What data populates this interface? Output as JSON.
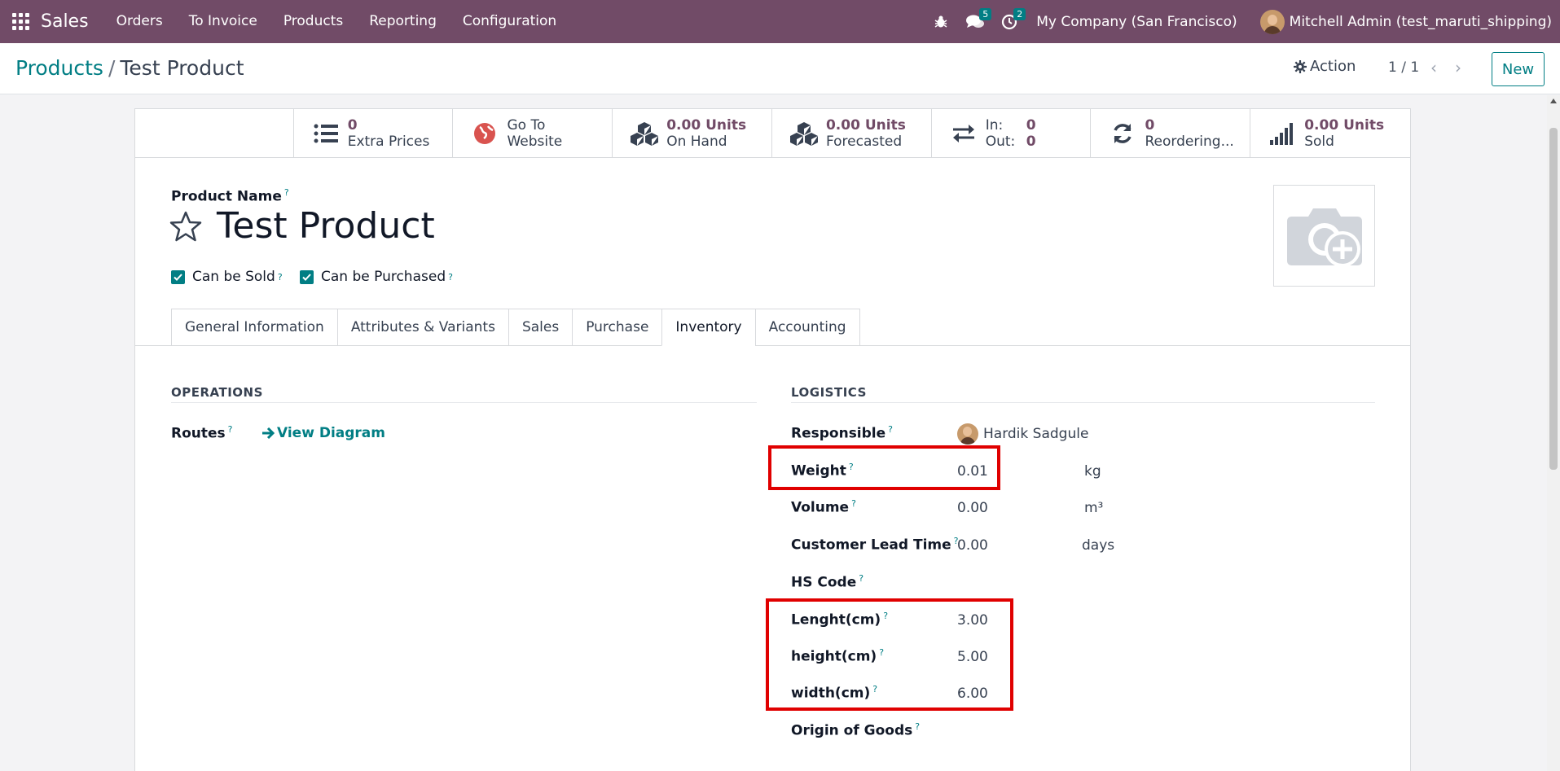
{
  "navbar": {
    "app_title": "Sales",
    "menu": [
      "Orders",
      "To Invoice",
      "Products",
      "Reporting",
      "Configuration"
    ],
    "messages_count": "5",
    "activities_count": "2",
    "company": "My Company (San Francisco)",
    "user": "Mitchell Admin (test_maruti_shipping)"
  },
  "control": {
    "breadcrumb_parent": "Products",
    "breadcrumb_sep": "/",
    "breadcrumb_current": "Test Product",
    "action_label": "Action",
    "pager": "1 / 1",
    "new_label": "New"
  },
  "stats": {
    "extra_prices": {
      "value": "0",
      "label": "Extra Prices"
    },
    "website": {
      "line1": "Go To",
      "line2": "Website"
    },
    "on_hand": {
      "value": "0.00 Units",
      "label": "On Hand"
    },
    "forecasted": {
      "value": "0.00 Units",
      "label": "Forecasted"
    },
    "inout": {
      "in_label": "In:",
      "in_value": "0",
      "out_label": "Out:",
      "out_value": "0"
    },
    "reordering": {
      "value": "0",
      "label": "Reordering..."
    },
    "sold": {
      "value": "0.00 Units",
      "label": "Sold"
    }
  },
  "product": {
    "name_label": "Product Name",
    "name": "Test Product",
    "can_be_sold": "Can be Sold",
    "can_be_purchased": "Can be Purchased"
  },
  "tabs": [
    "General Information",
    "Attributes & Variants",
    "Sales",
    "Purchase",
    "Inventory",
    "Accounting"
  ],
  "active_tab": "Inventory",
  "operations": {
    "title": "OPERATIONS",
    "routes_label": "Routes",
    "view_diagram": "View Diagram"
  },
  "logistics": {
    "title": "LOGISTICS",
    "responsible_label": "Responsible",
    "responsible_value": "Hardik Sadgule",
    "weight_label": "Weight",
    "weight_value": "0.01",
    "weight_unit": "kg",
    "volume_label": "Volume",
    "volume_value": "0.00",
    "volume_unit": "m³",
    "lead_time_label": "Customer Lead Time",
    "lead_time_value": "0.00",
    "lead_time_unit": "days",
    "hs_code_label": "HS Code",
    "length_label": "Lenght(cm)",
    "length_value": "3.00",
    "height_label": "height(cm)",
    "height_value": "5.00",
    "width_label": "width(cm)",
    "width_value": "6.00",
    "origin_label": "Origin of Goods"
  },
  "help_mark": "?",
  "colors": {
    "navbar": "#714b67",
    "accent": "#017e84",
    "stat_value": "#714b67",
    "highlight": "#e00000"
  }
}
